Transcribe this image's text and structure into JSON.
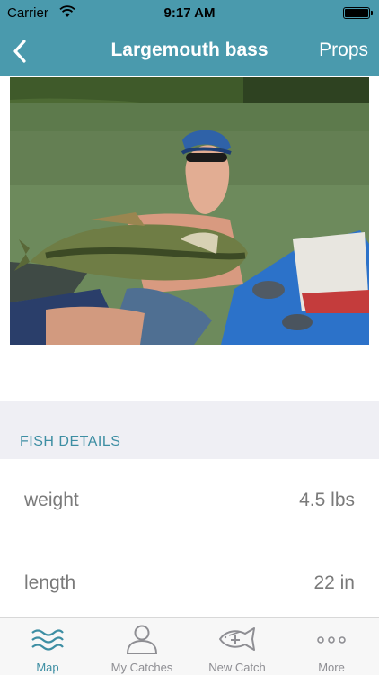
{
  "status_bar": {
    "carrier": "Carrier",
    "time": "9:17 AM"
  },
  "nav": {
    "title": "Largemouth bass",
    "right_button": "Props",
    "back_icon": "chevron-left-icon"
  },
  "photo": {
    "subject": "woman in cap and sunglasses holding a largemouth bass while seated in a blue kayak on a lake"
  },
  "section": {
    "header": "FISH DETAILS"
  },
  "details": [
    {
      "label": "weight",
      "value": "4.5 lbs"
    },
    {
      "label": "length",
      "value": "22 in"
    }
  ],
  "tabs": [
    {
      "label": "Map",
      "icon": "waves-icon",
      "active": true
    },
    {
      "label": "My Catches",
      "icon": "person-icon",
      "active": false
    },
    {
      "label": "New Catch",
      "icon": "fish-plus-icon",
      "active": false
    },
    {
      "label": "More",
      "icon": "more-dots-icon",
      "active": false
    }
  ],
  "colors": {
    "nav_background": "#4a9aad",
    "accent": "#3d8ea3",
    "section_background": "#efeff4",
    "text_secondary": "#7a7a7a",
    "tab_inactive": "#8e8e93"
  }
}
